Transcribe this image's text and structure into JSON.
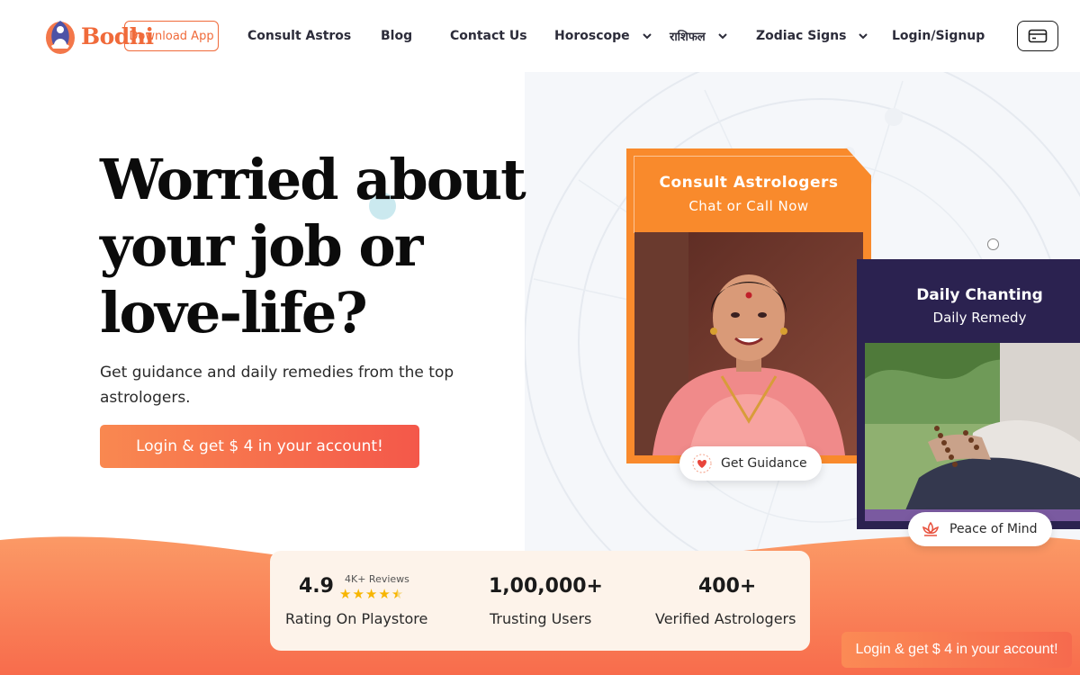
{
  "brand": {
    "name": "Bodhi",
    "accent": "#f06a3a"
  },
  "nav": {
    "download_label": "Download App",
    "consult_label": "Consult Astros",
    "blog_label": "Blog",
    "contact_label": "Contact Us",
    "horoscope_label": "Horoscope",
    "rashifal_label": "राशिफल",
    "zodiac_label": "Zodiac Signs",
    "login_label": "Login/Signup",
    "card_icon": "credit-card-icon"
  },
  "hero": {
    "title": "Worried about your job or love-life?",
    "subtitle": "Get guidance and daily remedies from the top astrologers.",
    "cta_label": "Login & get $ 4 in your account!"
  },
  "consult_card": {
    "title": "Consult Astrologers",
    "subtitle": "Chat or Call Now",
    "pill_label": "Get Guidance",
    "pill_icon": "heart-icon",
    "color": "#f98a2c"
  },
  "chant_card": {
    "title": "Daily Chanting",
    "subtitle": "Daily Remedy",
    "pill_label": "Peace of Mind",
    "pill_icon": "lotus-icon",
    "color": "#2b2250"
  },
  "stats": {
    "rating": {
      "value": "4.9",
      "reviews": "4K+ Reviews",
      "stars": 4.5,
      "label": "Rating On Playstore"
    },
    "users": {
      "value": "1,00,000+",
      "label": "Trusting Users"
    },
    "astrologers": {
      "value": "400+",
      "label": "Verified Astrologers"
    }
  },
  "floating_cta": {
    "label": "Login & get $ 4 in your account!"
  }
}
